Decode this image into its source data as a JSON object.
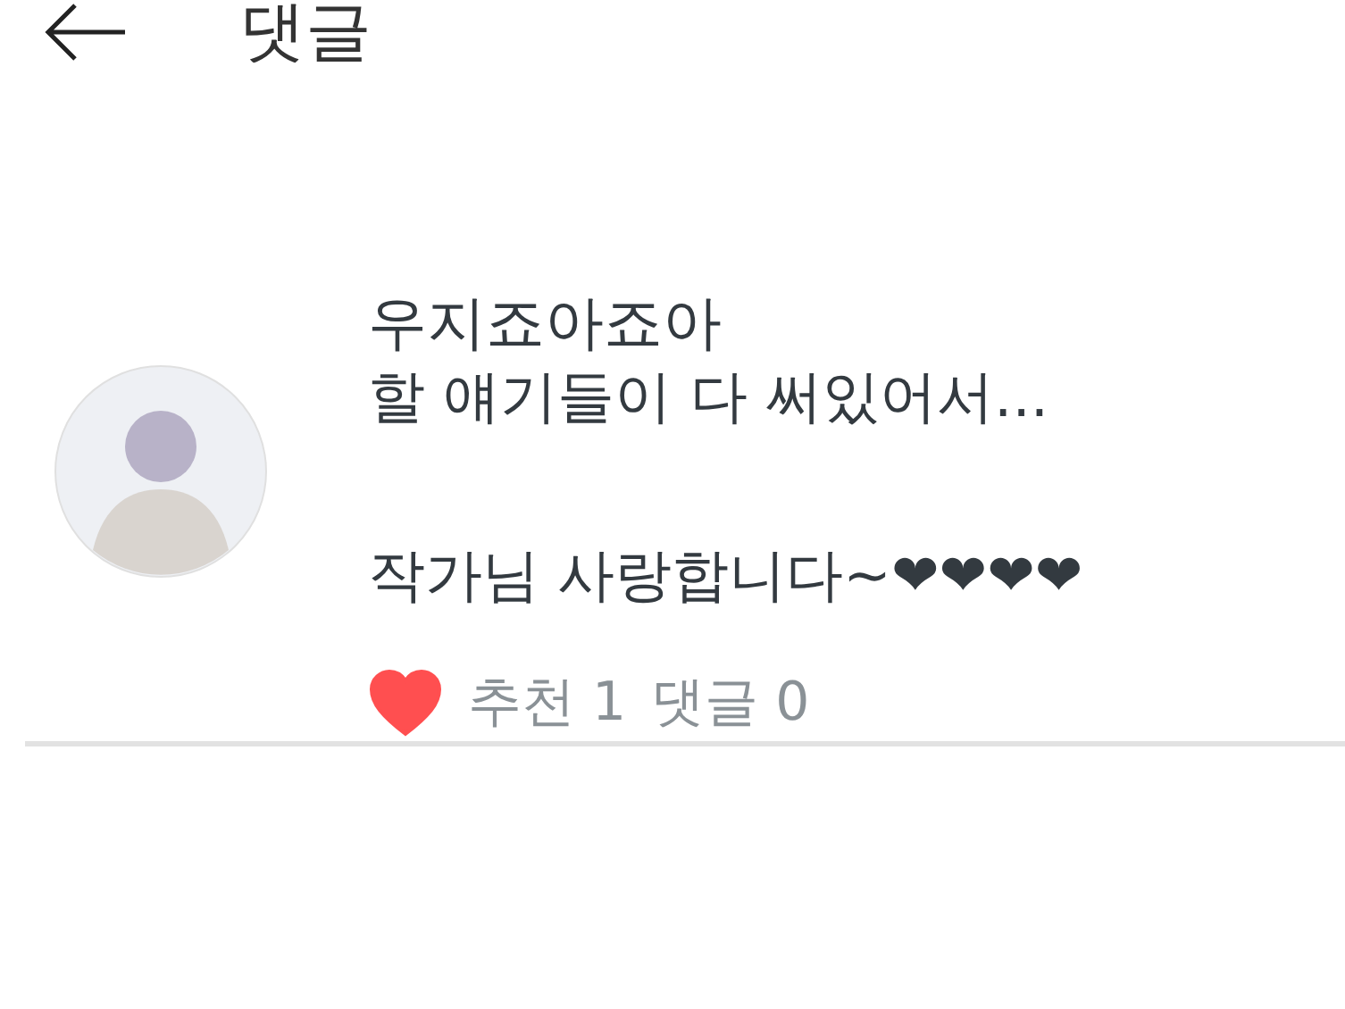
{
  "header": {
    "title": "댓글"
  },
  "comments": [
    {
      "author": "우지죠아죠아",
      "lines": [
        "할 얘기들이 다 써있어서...",
        "작가님 사랑합니다~❤❤❤❤"
      ],
      "liked": true,
      "likes": "추천 1",
      "replies": "댓글 0"
    }
  ]
}
